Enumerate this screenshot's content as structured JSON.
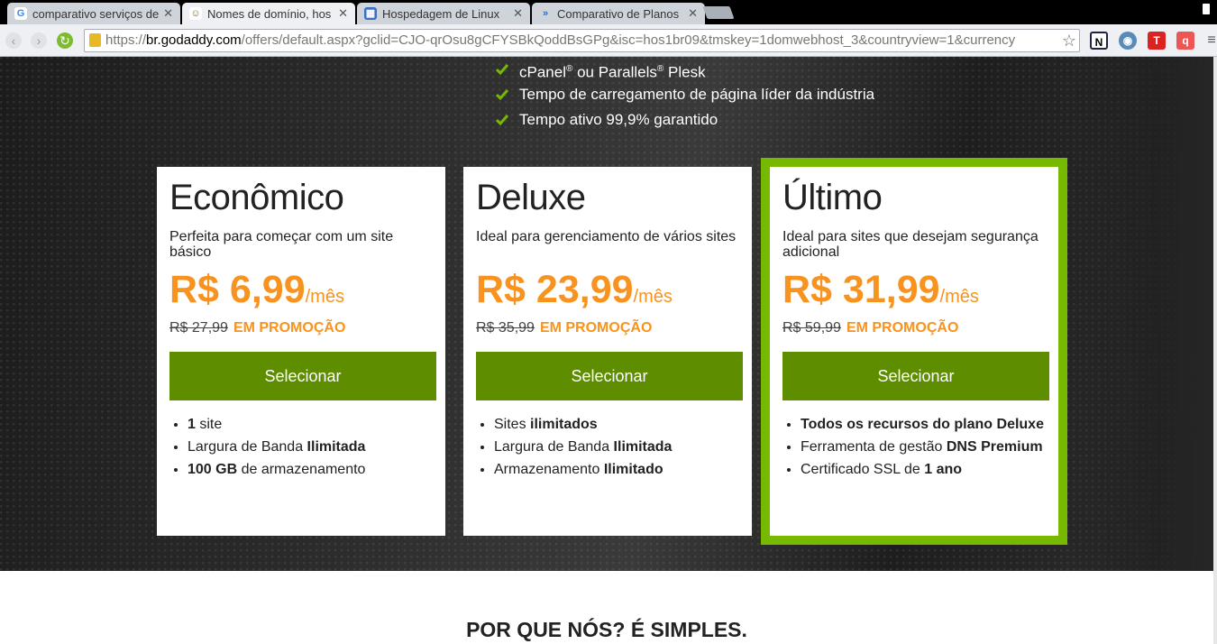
{
  "browser": {
    "tabs": [
      {
        "title": "comparativo serviços de",
        "favicon": "google-icon"
      },
      {
        "title": "Nomes de domínio, hos",
        "favicon": "godaddy-icon"
      },
      {
        "title": "Hospedagem de Linux",
        "favicon": "grid-icon"
      },
      {
        "title": "Comparativo de Planos",
        "favicon": "arrow-icon"
      }
    ],
    "close_glyph": "✕",
    "url_scheme": "https://",
    "url_host": "br.godaddy.com",
    "url_path": "/offers/default.aspx?gclid=CJO-qrOsu8gCFYSBkQoddBsGPg&isc=hos1br09&tmskey=1domwebhost_3&countryview=1&currency"
  },
  "features": [
    {
      "pre": "cPanel",
      "sup1": "®",
      "mid": " ou Parallels",
      "sup2": "®",
      "post": " Plesk"
    },
    {
      "text": "Tempo de carregamento de página líder da indústria"
    },
    {
      "text": "Tempo ativo 99,9% garantido"
    }
  ],
  "plans": [
    {
      "name": "Econômico",
      "description": "Perfeita para começar com um site básico",
      "price": "R$ 6,99",
      "unit": "/mês",
      "old_price": "R$ 27,99",
      "promo": "EM PROMOÇÃO",
      "button": "Selecionar",
      "items": [
        {
          "b1": "1",
          "t1": " site"
        },
        {
          "t1": "Largura de Banda ",
          "b1": "Ilimitada"
        },
        {
          "b1": "100 GB",
          "t1": " de armazenamento"
        }
      ]
    },
    {
      "name": "Deluxe",
      "description": "Ideal para gerenciamento de vários sites",
      "price": "R$ 23,99",
      "unit": "/mês",
      "old_price": "R$ 35,99",
      "promo": "EM PROMOÇÃO",
      "button": "Selecionar",
      "items": [
        {
          "t1": "Sites ",
          "b1": "ilimitados"
        },
        {
          "t1": "Largura de Banda ",
          "b1": "Ilimitada"
        },
        {
          "t1": "Armazenamento ",
          "b1": "Ilimitado"
        }
      ]
    },
    {
      "name": "Último",
      "description": "Ideal para sites que desejam segurança adicional",
      "price": "R$ 31,99",
      "unit": "/mês",
      "old_price": "R$ 59,99",
      "promo": "EM PROMOÇÃO",
      "button": "Selecionar",
      "items": [
        {
          "b1": "Todos os recursos do plano Deluxe"
        },
        {
          "t1": "Ferramenta de gestão ",
          "b1": "DNS Premium"
        },
        {
          "t1": "Certificado SSL de ",
          "b1": "1 ano"
        }
      ]
    }
  ],
  "section_title": "POR QUE NÓS? É SIMPLES.",
  "colors": {
    "accent": "#f7931e",
    "button": "#5e8e00",
    "featured_border": "#76b900"
  }
}
